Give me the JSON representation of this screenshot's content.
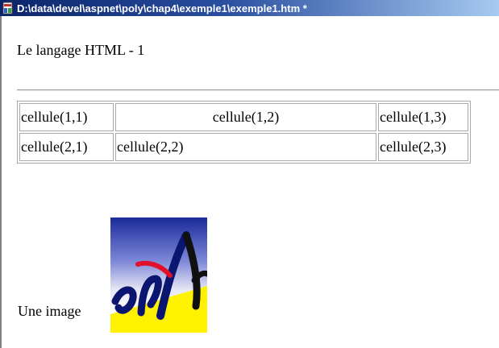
{
  "window": {
    "title": "D:\\data\\devel\\aspnet\\poly\\chap4\\exemple1\\exemple1.htm *",
    "icon": "html-document-icon"
  },
  "document": {
    "heading": "Le langage HTML - 1",
    "table": {
      "rows": [
        [
          "cellule(1,1)",
          "cellule(1,2)",
          "cellule(1,3)"
        ],
        [
          "cellule(2,1)",
          "cellule(2,2)",
          "cellule(2,3)"
        ]
      ]
    },
    "image_caption": "Une image",
    "image": "logo-image"
  }
}
